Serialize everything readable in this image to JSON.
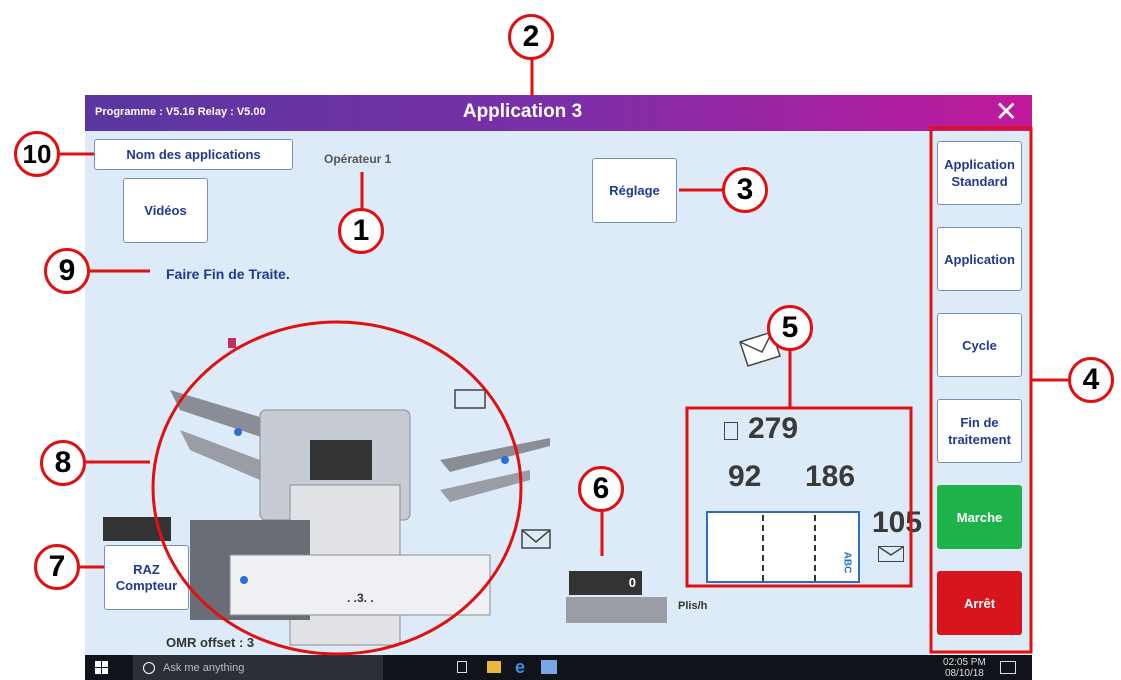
{
  "titlebar": {
    "program": "Programme : V5.16 Relay : V5.00",
    "title": "Application 3",
    "close": "✕"
  },
  "main": {
    "apps_button": "Nom des applications",
    "operator": "Opérateur 1",
    "videos_button": "Vidéos",
    "settings_button": "Réglage",
    "message": "Faire Fin de Traite.",
    "reset_button": "RAZ\nCompteur",
    "omr_label": "OMR offset :",
    "omr_value": "3",
    "machine_label": ". .3. ."
  },
  "counters": {
    "sheets": "279",
    "left": "92",
    "right": "186",
    "envelopes": "105",
    "abc": "ABC",
    "rate_value": "0",
    "rate_unit": "Plis/h"
  },
  "side": {
    "standard": "Application Standard",
    "application": "Application",
    "cycle": "Cycle",
    "end": "Fin de traitement",
    "start": "Marche",
    "stop": "Arrêt"
  },
  "taskbar": {
    "search_placeholder": "Ask me anything",
    "time": "02:05 PM",
    "date": "08/10/18"
  },
  "annotations": [
    "1",
    "2",
    "3",
    "4",
    "5",
    "6",
    "7",
    "8",
    "9",
    "10"
  ],
  "colors": {
    "title_start": "#5a37a0",
    "title_end": "#c2189c",
    "background": "#dcebf7",
    "button_text": "#1f3a8f",
    "start": "#1db34a",
    "stop": "#d8141d",
    "annotation": "#e01010"
  }
}
